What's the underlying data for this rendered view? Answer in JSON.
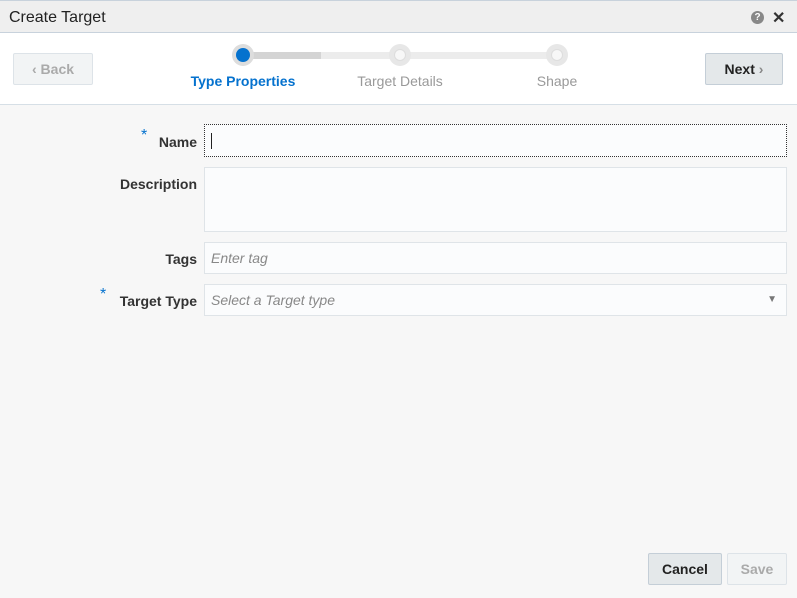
{
  "dialog": {
    "title": "Create Target",
    "help_icon": "question-circle-icon",
    "close_icon": "close-icon"
  },
  "train": {
    "back_label": "Back",
    "next_label": "Next",
    "steps": [
      {
        "label": "Type Properties",
        "state": "active"
      },
      {
        "label": "Target Details",
        "state": "pending"
      },
      {
        "label": "Shape",
        "state": "pending"
      }
    ]
  },
  "form": {
    "name": {
      "label": "Name",
      "required": "*",
      "value": ""
    },
    "description": {
      "label": "Description",
      "value": ""
    },
    "tags": {
      "label": "Tags",
      "placeholder": "Enter tag"
    },
    "target_type": {
      "label": "Target Type",
      "required": "*",
      "placeholder": "Select a Target type"
    }
  },
  "footer": {
    "cancel_label": "Cancel",
    "save_label": "Save"
  },
  "colors": {
    "accent": "#0572ce"
  }
}
